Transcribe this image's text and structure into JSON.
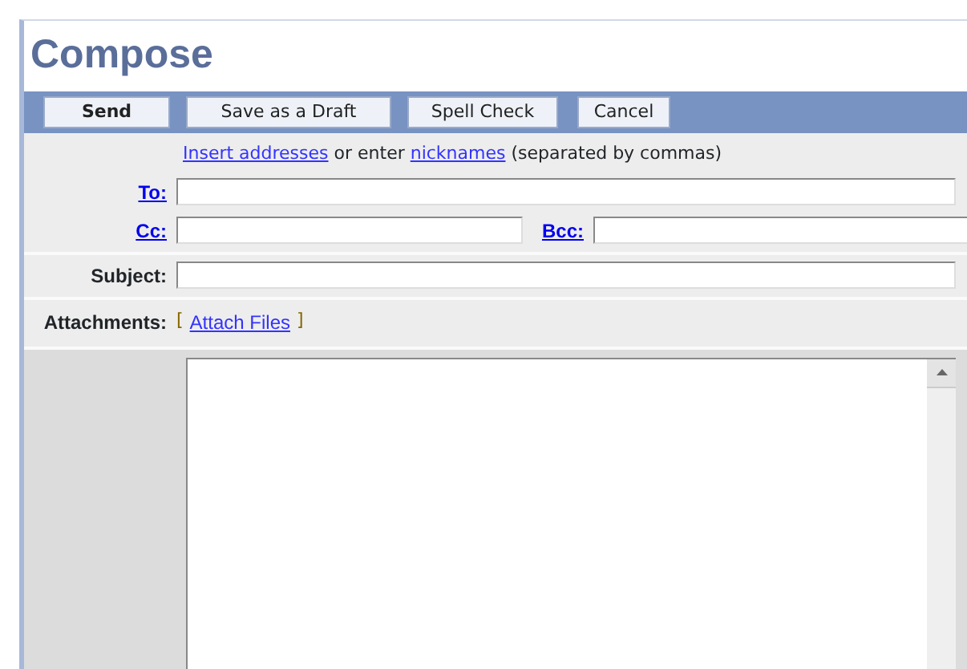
{
  "title": "Compose",
  "toolbar": [
    {
      "label": "Send",
      "default": true
    },
    {
      "label": "Save as a Draft",
      "default": false
    },
    {
      "label": "Spell Check",
      "default": false
    },
    {
      "label": "Cancel",
      "default": false
    }
  ],
  "address_hint": [
    {
      "kind": "link",
      "text": "Insert addresses"
    },
    {
      "kind": "text",
      "text": " or enter "
    },
    {
      "kind": "link",
      "text": "nicknames"
    },
    {
      "kind": "text",
      "text": " (separated by commas)"
    }
  ],
  "to": {
    "label": "To:"
  },
  "cc": {
    "label": "Cc:"
  },
  "bcc": {
    "label": "Bcc:"
  },
  "subject": {
    "label": "Subject:"
  },
  "attachments": {
    "label": "Attachments:",
    "open_bracket": "[",
    "link": "Attach Files",
    "close_bracket": "]"
  }
}
